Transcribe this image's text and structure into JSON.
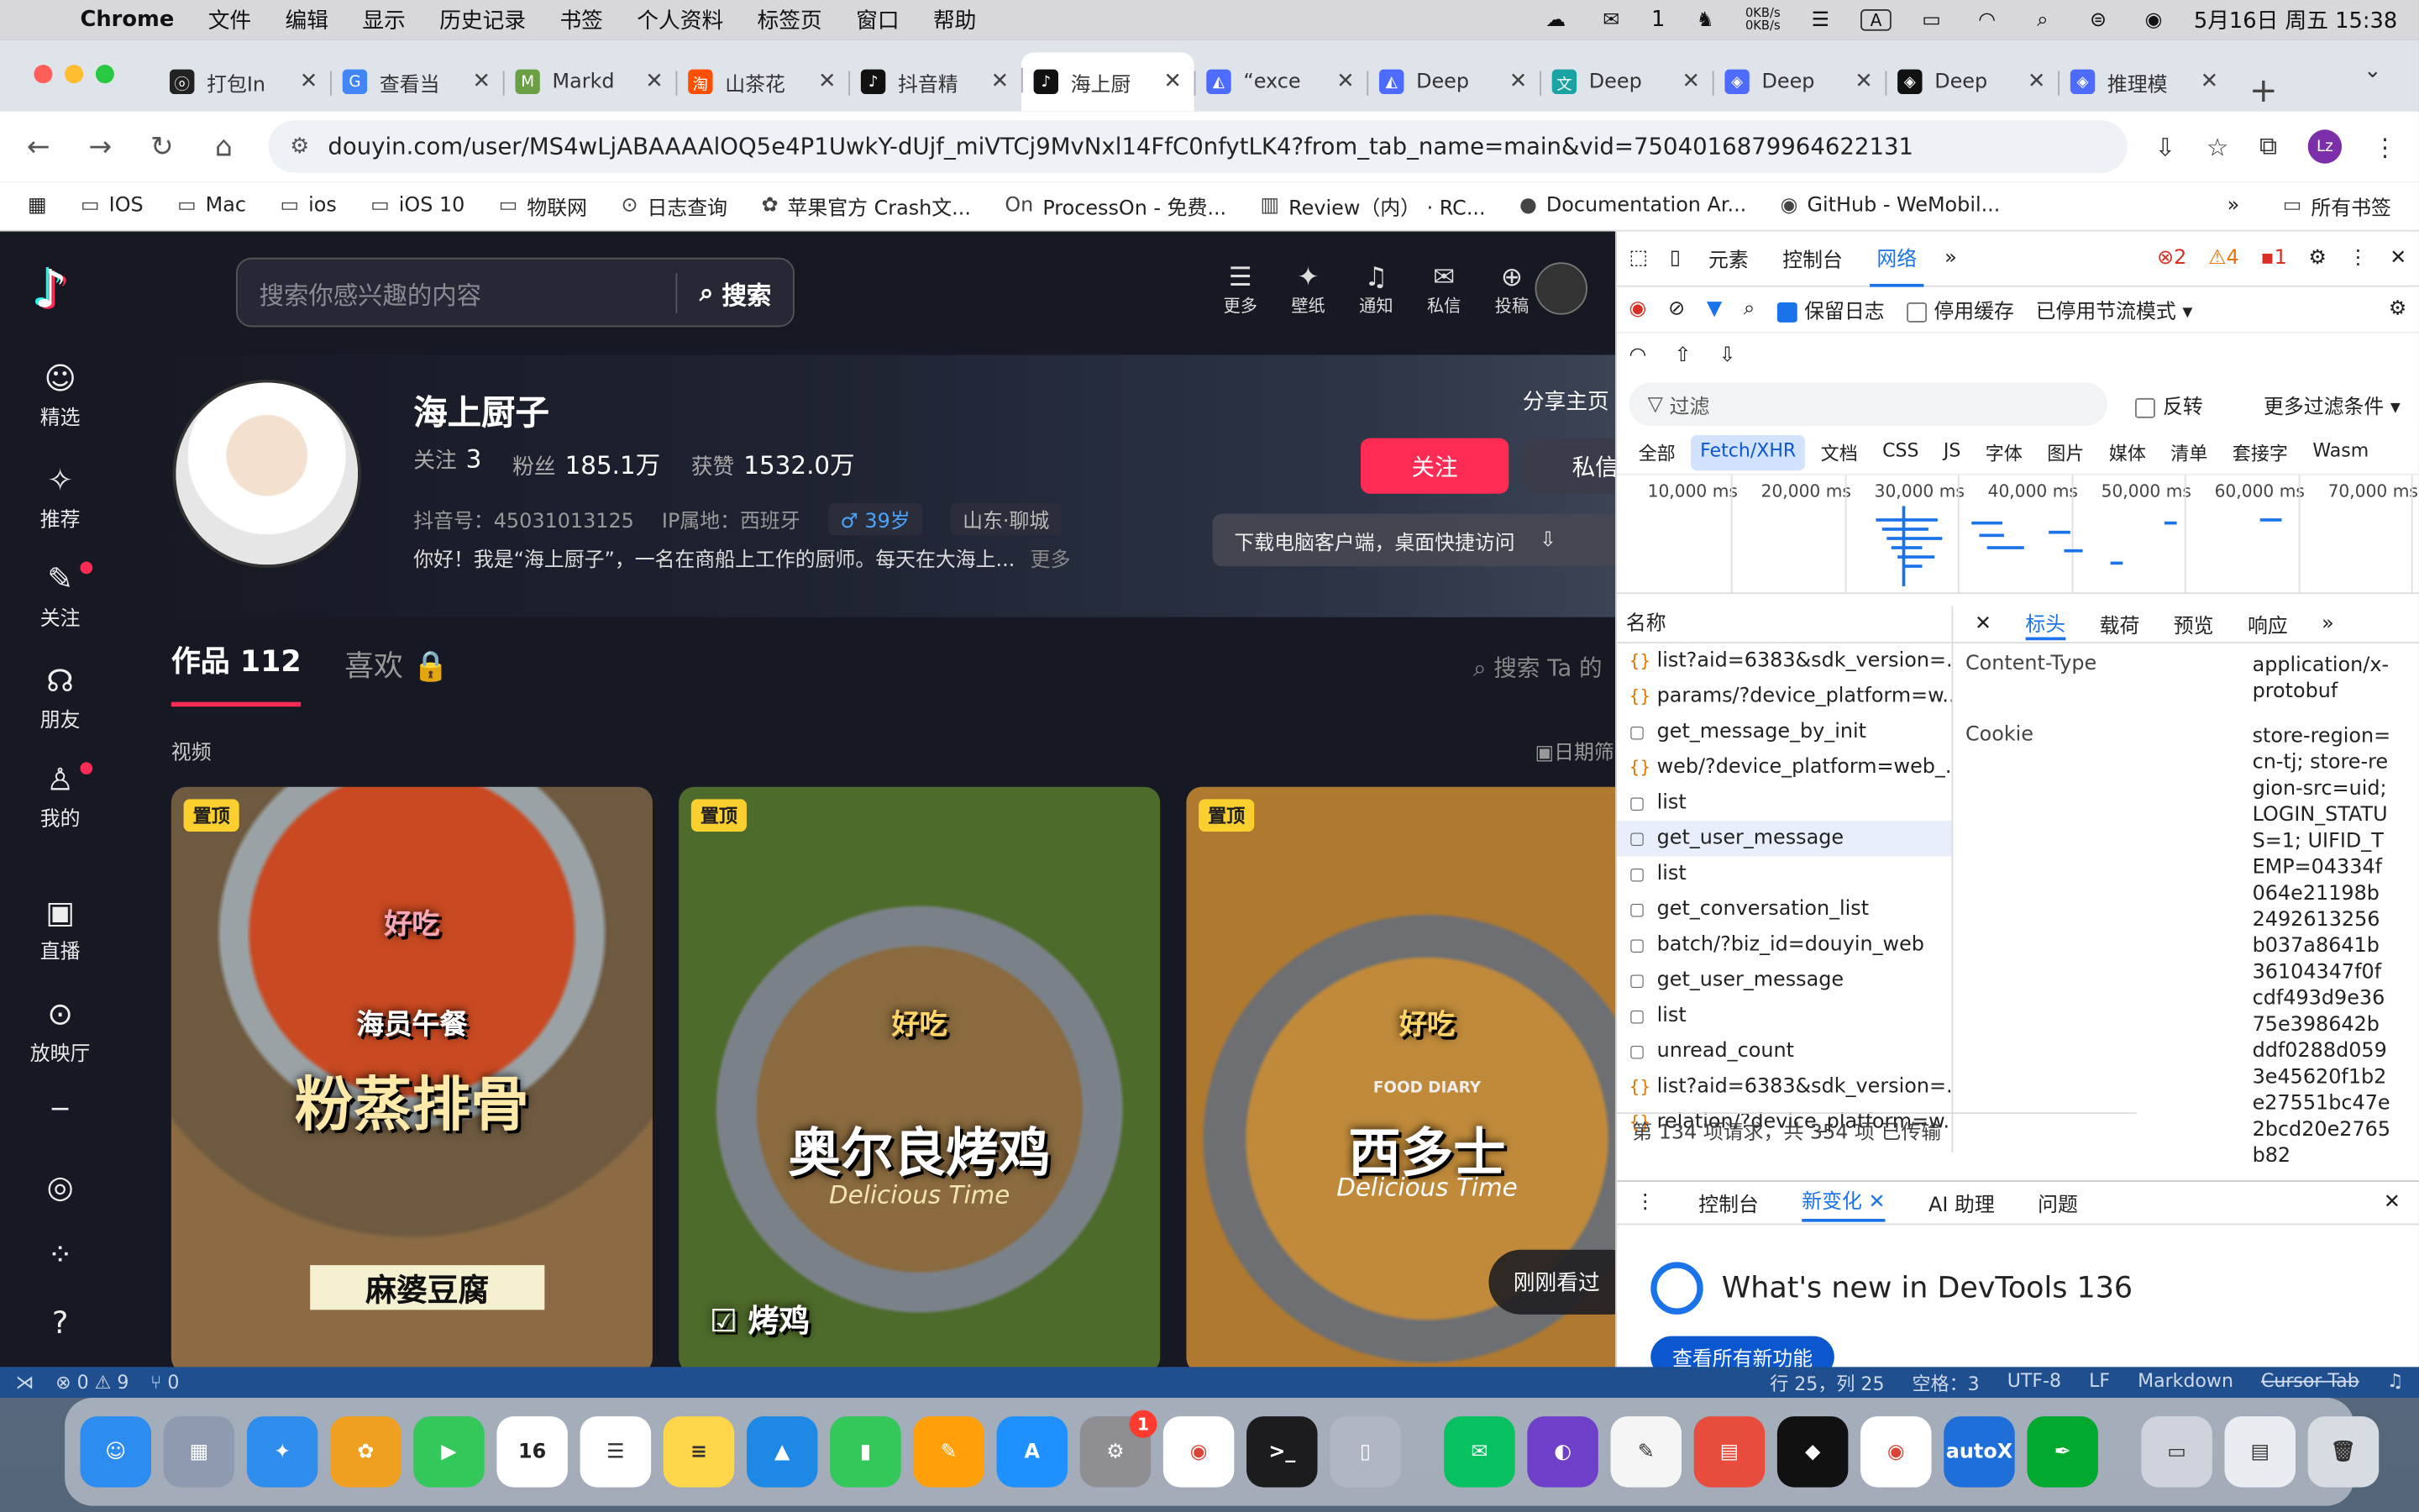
{
  "menubar": {
    "app": "Chrome",
    "items": [
      "文件",
      "编辑",
      "显示",
      "历史记录",
      "书签",
      "个人资料",
      "标签页",
      "窗口",
      "帮助"
    ],
    "wechat_count": "1",
    "net_up": "0KB/s",
    "net_down": "0KB/s",
    "input_label": "A",
    "datetime": "5月16日 周五  15:38"
  },
  "tabs": [
    {
      "title": "打包In",
      "fav": "ⓞ",
      "color": "#222"
    },
    {
      "title": "查看当",
      "fav": "G",
      "color": "#4285f4"
    },
    {
      "title": "Markd",
      "fav": "M",
      "color": "#6a9f43"
    },
    {
      "title": "山茶花",
      "fav": "淘",
      "color": "#ff5000"
    },
    {
      "title": "抖音精",
      "fav": "♪",
      "color": "#111"
    },
    {
      "title": "海上厨",
      "fav": "♪",
      "color": "#111"
    },
    {
      "title": "“exce",
      "fav": "◭",
      "color": "#4d6bfe"
    },
    {
      "title": "Deep",
      "fav": "◭",
      "color": "#4d6bfe"
    },
    {
      "title": "Deep",
      "fav": "文",
      "color": "#1aa3a3"
    },
    {
      "title": "Deep",
      "fav": "◈",
      "color": "#4d6bfe"
    },
    {
      "title": "Deep",
      "fav": "◈",
      "color": "#111"
    },
    {
      "title": "推理模",
      "fav": "◈",
      "color": "#4d6bfe"
    }
  ],
  "address": {
    "url": "douyin.com/user/MS4wLjABAAAAlOQ5e4P1UwkY-dUjf_miVTCj9MvNxl14FfC0nfytLK4?from_tab_name=main&vid=7504016879964622131",
    "profile_initials": "Lz"
  },
  "bookmarks": [
    "IOS",
    "Mac",
    "ios",
    "iOS 10",
    "物联网",
    "日志查询",
    "苹果官方 Crash文...",
    "ProcessOn - 免费...",
    "Review（内） · RC...",
    "Documentation Ar...",
    "GitHub - WeMobil..."
  ],
  "bookmarks_more": "»",
  "bookmarks_all": "所有书签",
  "douyin": {
    "search_placeholder": "搜索你感兴趣的内容",
    "search_button": "搜索",
    "nav": [
      {
        "label": "精选",
        "icon": "☺"
      },
      {
        "label": "推荐",
        "icon": "✧"
      },
      {
        "label": "关注",
        "icon": "✎"
      },
      {
        "label": "朋友",
        "icon": "☊"
      },
      {
        "label": "我的",
        "icon": "♙"
      },
      {
        "label": "直播",
        "icon": "▣"
      },
      {
        "label": "放映厅",
        "icon": "⊙"
      }
    ],
    "top_icons": [
      {
        "label": "更多",
        "icon": "☰"
      },
      {
        "label": "壁纸",
        "icon": "✦"
      },
      {
        "label": "通知",
        "icon": "♫"
      },
      {
        "label": "私信",
        "icon": "✉"
      },
      {
        "label": "投稿",
        "icon": "⊕"
      }
    ],
    "profile": {
      "name": "海上厨子",
      "following_label": "关注",
      "following": "3",
      "fans_label": "粉丝",
      "fans": "185.1万",
      "likes_label": "获赞",
      "likes": "1532.0万",
      "douyin_id": "抖音号：45031013125",
      "ip": "IP属地：西班牙",
      "age": "♂ 39岁",
      "location": "山东·聊城",
      "bio": "你好！我是“海上厨子”，一名在商船上工作的厨师。每天在大海上...",
      "bio_more": "更多"
    },
    "share": "分享主页",
    "follow_button": "关注",
    "message_button": "私信",
    "download_bar": "下载电脑客户端，桌面快捷访问",
    "works_tab": "作品 112",
    "likes_tab": "喜欢",
    "search_ta": "搜索 Ta 的",
    "section_label": "视频",
    "date_filter": "日期筛",
    "videos": [
      {
        "pin": "置顶",
        "title": "粉蒸排骨",
        "sub": "海员午餐",
        "tag": "麻婆豆腐",
        "heart": "好吃"
      },
      {
        "pin": "置顶",
        "title": "奥尔良烤鸡",
        "sub": "Delicious Time",
        "tag": "烤鸡",
        "heart": "好吃"
      },
      {
        "pin": "置顶",
        "title": "西多士",
        "sub": "Delicious Time",
        "tag": "FOOD DIARY",
        "heart": "好吃"
      }
    ],
    "just_watched": "刚刚看过"
  },
  "devtools": {
    "tabs": [
      "元素",
      "控制台",
      "网络"
    ],
    "active_tab": "网络",
    "errors": "2",
    "warnings": "4",
    "issues": "1",
    "preserve_log": "保留日志",
    "disable_cache": "停用缓存",
    "throttle": "已停用节流模式",
    "filter_placeholder": "过滤",
    "invert": "反转",
    "more_filters": "更多过滤条件",
    "types": [
      "全部",
      "Fetch/XHR",
      "文档",
      "CSS",
      "JS",
      "字体",
      "图片",
      "媒体",
      "清单",
      "套接字",
      "Wasm"
    ],
    "timeline_labels": [
      "10,000 ms",
      "20,000 ms",
      "30,000 ms",
      "40,000 ms",
      "50,000 ms",
      "60,000 ms",
      "70,000 ms"
    ],
    "name_header": "名称",
    "requests": [
      {
        "name": "list?aid=6383&sdk_version=...",
        "type": "xhr"
      },
      {
        "name": "params/?device_platform=w...",
        "type": "xhr"
      },
      {
        "name": "get_message_by_init",
        "type": "doc"
      },
      {
        "name": "web/?device_platform=web_...",
        "type": "xhr"
      },
      {
        "name": "list",
        "type": "doc"
      },
      {
        "name": "get_user_message",
        "type": "doc"
      },
      {
        "name": "list",
        "type": "doc"
      },
      {
        "name": "get_conversation_list",
        "type": "doc"
      },
      {
        "name": "batch/?biz_id=douyin_web",
        "type": "doc"
      },
      {
        "name": "get_user_message",
        "type": "doc"
      },
      {
        "name": "list",
        "type": "doc"
      },
      {
        "name": "unread_count",
        "type": "doc"
      },
      {
        "name": "list?aid=6383&sdk_version=...",
        "type": "xhr"
      },
      {
        "name": "relation/?device_platform=w...",
        "type": "xhr"
      }
    ],
    "selected_index": 5,
    "detail_tabs": [
      "标头",
      "载荷",
      "预览",
      "响应"
    ],
    "headers": [
      {
        "key": "Content-Type",
        "value": "application/x-protobuf"
      },
      {
        "key": "Cookie",
        "value": "store-region=cn-tj; store-region-src=uid; LOGIN_STATUS=1; UIFID_TEMP=04334f064e21198b2492613256b037a8641b36104347f0fcdf493d9e3675e398642bddf0288d0593e45620f1b2e27551bc47e2bcd20e2765b82"
      }
    ],
    "footer": "第 134 项请求，共 354 项   已传输",
    "drawer_tabs": [
      "控制台",
      "新变化",
      "AI 助理",
      "问题"
    ],
    "drawer_active": "新变化",
    "whats_new": "What's new in DevTools 136",
    "see_all": "查看所有新功能"
  },
  "statusbar": {
    "errors": "⊗ 0 ⚠ 9",
    "ports": "⑂ 0",
    "position": "行 25，列 25",
    "spaces": "空格：3",
    "encoding": "UTF-8",
    "eol": "LF",
    "language": "Markdown",
    "cursor_tab": "Cursor Tab"
  },
  "dock": [
    {
      "name": "finder",
      "label": "☺",
      "color": "#2d8cf0"
    },
    {
      "name": "launchpad",
      "label": "▦",
      "color": "#8e9aaf"
    },
    {
      "name": "safari",
      "label": "✦",
      "color": "#2f8ded"
    },
    {
      "name": "photos",
      "label": "✿",
      "color": "#f0a020"
    },
    {
      "name": "facetime",
      "label": "▶",
      "color": "#34c759"
    },
    {
      "name": "calendar",
      "label": "16",
      "color": "#ffffff",
      "fg": "#222"
    },
    {
      "name": "reminders",
      "label": "☰",
      "color": "#ffffff",
      "fg": "#333"
    },
    {
      "name": "notes",
      "label": "≡",
      "color": "#ffd54a",
      "fg": "#333"
    },
    {
      "name": "keynote",
      "label": "▲",
      "color": "#1e88e5"
    },
    {
      "name": "numbers",
      "label": "▮",
      "color": "#34c759"
    },
    {
      "name": "pages",
      "label": "✎",
      "color": "#ff9f0a"
    },
    {
      "name": "app-store",
      "label": "A",
      "color": "#1e90ff"
    },
    {
      "name": "system-settings",
      "label": "⚙",
      "color": "#8e8e93",
      "badge": "1"
    },
    {
      "name": "chrome",
      "label": "◉",
      "color": "#ffffff",
      "fg": "#db4437"
    },
    {
      "name": "terminal",
      "label": ">_",
      "color": "#1c1c1e"
    },
    {
      "name": "iphone-mirroring",
      "label": "▯",
      "color": "#b0b6c2"
    },
    {
      "name": "wechat",
      "label": "✉",
      "color": "#07c160"
    },
    {
      "name": "github-desktop",
      "label": "◐",
      "color": "#6e40c9"
    },
    {
      "name": "textedit",
      "label": "✎",
      "color": "#f5f5f5",
      "fg": "#333"
    },
    {
      "name": "wps",
      "label": "▤",
      "color": "#e74c3c"
    },
    {
      "name": "cursor",
      "label": "◆",
      "color": "#111111"
    },
    {
      "name": "chrome-2",
      "label": "◉",
      "color": "#ffffff",
      "fg": "#db4437"
    },
    {
      "name": "autox",
      "label": "autoX",
      "color": "#1e6fd9"
    },
    {
      "name": "evernote",
      "label": "✒",
      "color": "#00a82d"
    },
    {
      "name": "finder-window",
      "label": "▭",
      "color": "#cfd4dc",
      "fg": "#333"
    },
    {
      "name": "document-stack",
      "label": "▤",
      "color": "#e9edf2",
      "fg": "#333"
    },
    {
      "name": "trash",
      "label": "🗑",
      "color": "#d7dbe2",
      "fg": "#333"
    }
  ]
}
